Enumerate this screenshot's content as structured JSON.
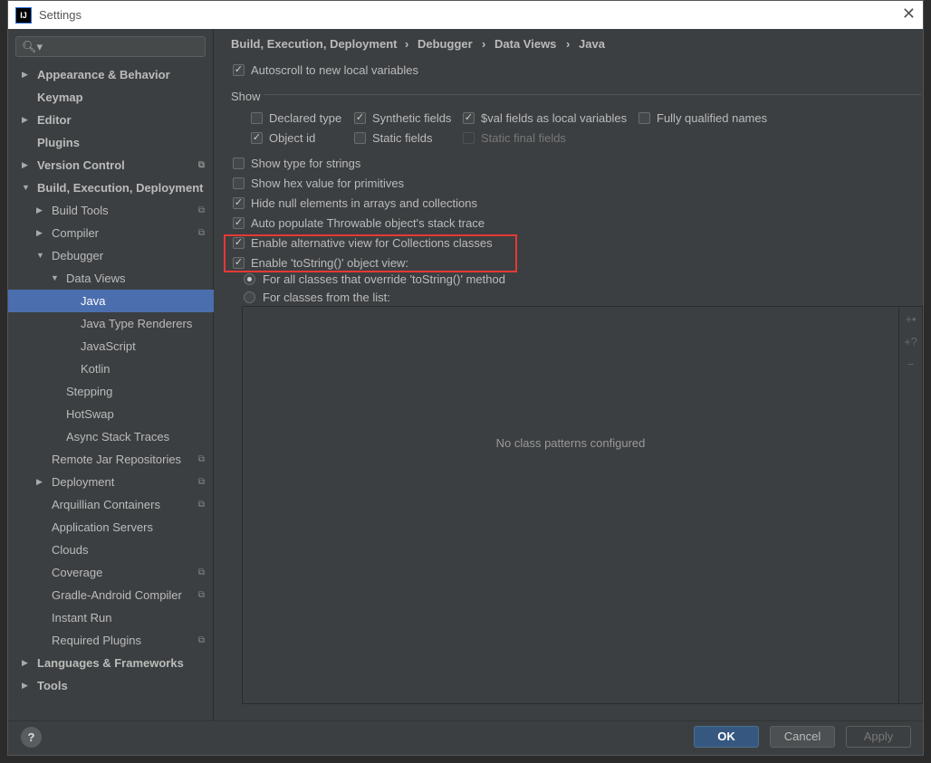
{
  "window": {
    "title": "Settings",
    "logo": "IJ",
    "close_icon": "close-icon"
  },
  "search": {
    "icon": "search-icon",
    "value": ""
  },
  "tree": [
    {
      "label": "Appearance & Behavior",
      "level": 0,
      "arrow": "right",
      "bold": true
    },
    {
      "label": "Keymap",
      "level": 0,
      "arrow": "none",
      "bold": true
    },
    {
      "label": "Editor",
      "level": 0,
      "arrow": "right",
      "bold": true
    },
    {
      "label": "Plugins",
      "level": 0,
      "arrow": "none",
      "bold": true
    },
    {
      "label": "Version Control",
      "level": 0,
      "arrow": "right",
      "bold": true,
      "copy": true
    },
    {
      "label": "Build, Execution, Deployment",
      "level": 0,
      "arrow": "down",
      "bold": true
    },
    {
      "label": "Build Tools",
      "level": 1,
      "arrow": "right",
      "copy": true
    },
    {
      "label": "Compiler",
      "level": 1,
      "arrow": "right",
      "copy": true
    },
    {
      "label": "Debugger",
      "level": 1,
      "arrow": "down"
    },
    {
      "label": "Data Views",
      "level": 2,
      "arrow": "down"
    },
    {
      "label": "Java",
      "level": 3,
      "arrow": "none",
      "selected": true
    },
    {
      "label": "Java Type Renderers",
      "level": 3,
      "arrow": "none"
    },
    {
      "label": "JavaScript",
      "level": 3,
      "arrow": "none"
    },
    {
      "label": "Kotlin",
      "level": 3,
      "arrow": "none"
    },
    {
      "label": "Stepping",
      "level": 2,
      "arrow": "none"
    },
    {
      "label": "HotSwap",
      "level": 2,
      "arrow": "none"
    },
    {
      "label": "Async Stack Traces",
      "level": 2,
      "arrow": "none"
    },
    {
      "label": "Remote Jar Repositories",
      "level": 1,
      "arrow": "none",
      "copy": true
    },
    {
      "label": "Deployment",
      "level": 1,
      "arrow": "right",
      "copy": true
    },
    {
      "label": "Arquillian Containers",
      "level": 1,
      "arrow": "none",
      "copy": true
    },
    {
      "label": "Application Servers",
      "level": 1,
      "arrow": "none"
    },
    {
      "label": "Clouds",
      "level": 1,
      "arrow": "none"
    },
    {
      "label": "Coverage",
      "level": 1,
      "arrow": "none",
      "copy": true
    },
    {
      "label": "Gradle-Android Compiler",
      "level": 1,
      "arrow": "none",
      "copy": true
    },
    {
      "label": "Instant Run",
      "level": 1,
      "arrow": "none"
    },
    {
      "label": "Required Plugins",
      "level": 1,
      "arrow": "none",
      "copy": true
    },
    {
      "label": "Languages & Frameworks",
      "level": 0,
      "arrow": "right",
      "bold": true
    },
    {
      "label": "Tools",
      "level": 0,
      "arrow": "right",
      "bold": true
    }
  ],
  "breadcrumb": [
    "Build, Execution, Deployment",
    "Debugger",
    "Data Views",
    "Java"
  ],
  "options": {
    "autoscroll": {
      "label": "Autoscroll to new local variables",
      "checked": true
    },
    "show_label": "Show",
    "show": [
      {
        "label": "Declared type",
        "checked": false
      },
      {
        "label": "Synthetic fields",
        "checked": true
      },
      {
        "label": "$val fields as local variables",
        "checked": true
      },
      {
        "label": "Fully qualified names",
        "checked": false
      },
      {
        "label": "Object id",
        "checked": true
      },
      {
        "label": "Static fields",
        "checked": false
      },
      {
        "label": "Static final fields",
        "checked": false,
        "disabled": true
      }
    ],
    "general": [
      {
        "label": "Show type for strings",
        "checked": false
      },
      {
        "label": "Show hex value for primitives",
        "checked": false
      },
      {
        "label": "Hide null elements in arrays and collections",
        "checked": true
      },
      {
        "label": "Auto populate Throwable object's stack trace",
        "checked": true
      },
      {
        "label": "Enable alternative view for Collections classes",
        "checked": true
      },
      {
        "label": "Enable 'toString()' object view:",
        "checked": true
      }
    ],
    "radios": [
      {
        "label": "For all classes that override 'toString()' method",
        "selected": true
      },
      {
        "label": "For classes from the list:",
        "selected": false
      }
    ]
  },
  "list": {
    "empty_text": "No class patterns configured",
    "tools": [
      "add-pattern-icon",
      "add-class-icon",
      "remove-icon"
    ]
  },
  "footer": {
    "help": "?",
    "ok": "OK",
    "cancel": "Cancel",
    "apply": "Apply"
  },
  "colors": {
    "accent": "#4b6eaf",
    "highlight": "#e53935",
    "background": "#3c3f41"
  }
}
